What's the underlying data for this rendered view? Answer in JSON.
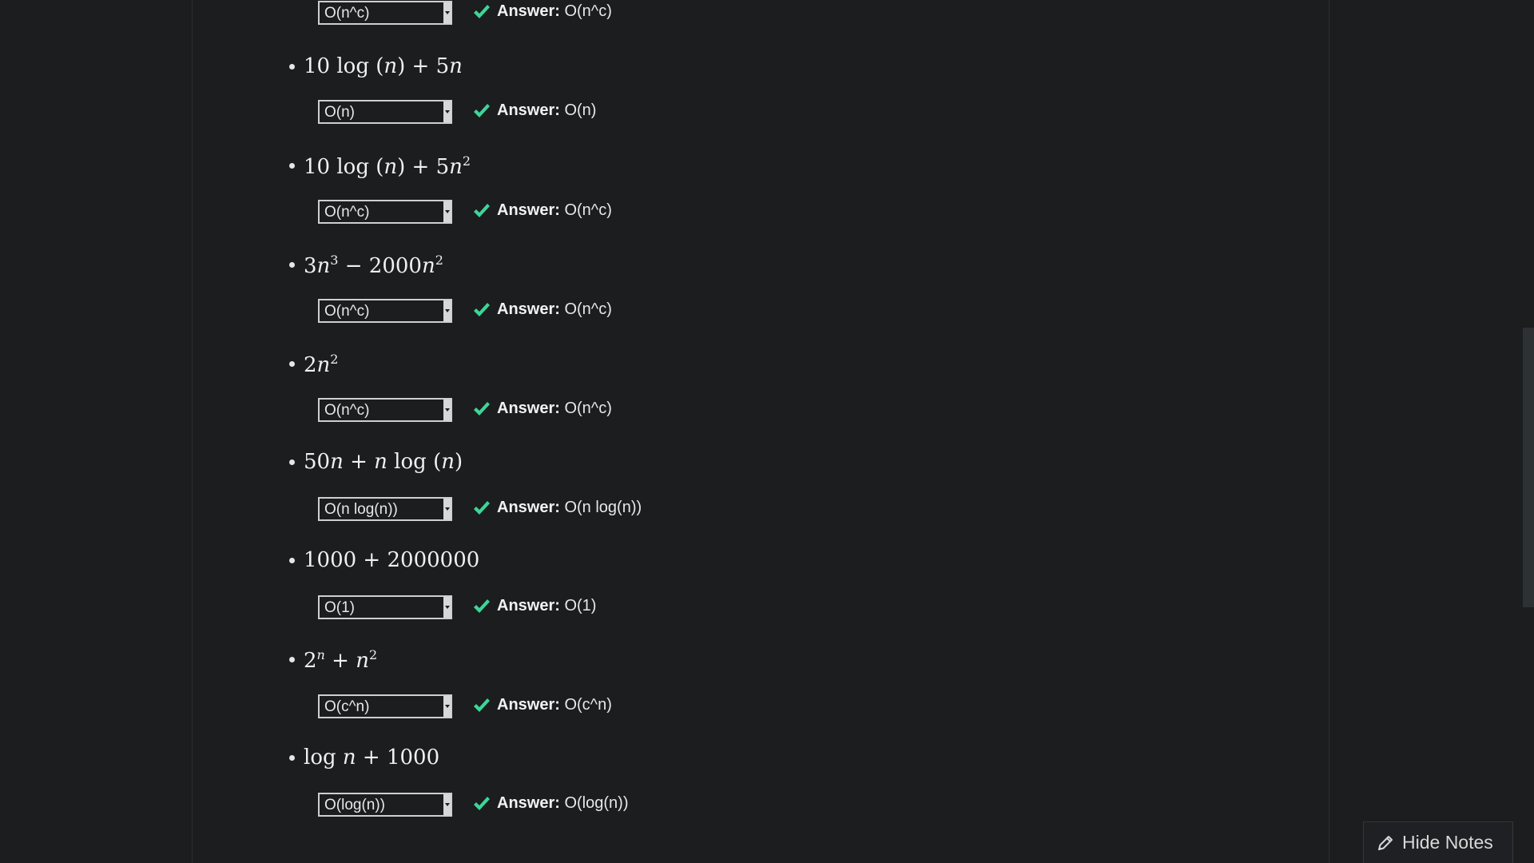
{
  "answer_label": "Answer:",
  "accent_color": "#3ed598",
  "questions": [
    {
      "expr_html": "",
      "selected": "O(n^c)",
      "answer": "O(n^c)"
    },
    {
      "expr_html": "10 log (<i>n</i>) + 5<i>n</i>",
      "selected": "O(n)",
      "answer": "O(n)"
    },
    {
      "expr_html": "10 log (<i>n</i>) + 5<i>n</i><sup>2</sup>",
      "selected": "O(n^c)",
      "answer": "O(n^c)"
    },
    {
      "expr_html": "3<i>n</i><sup>3</sup> − 2000<i>n</i><sup>2</sup>",
      "selected": "O(n^c)",
      "answer": "O(n^c)"
    },
    {
      "expr_html": "2<i>n</i><sup>2</sup>",
      "selected": "O(n^c)",
      "answer": "O(n^c)"
    },
    {
      "expr_html": "50<i>n</i> + <i>n</i> log (<i>n</i>)",
      "selected": "O(n log(n))",
      "answer": "O(n log(n))"
    },
    {
      "expr_html": "1000 + 2000000",
      "selected": "O(1)",
      "answer": "O(1)"
    },
    {
      "expr_html": "2<sup><i>n</i></sup> + <i>n</i><sup>2</sup>",
      "selected": "O(c^n)",
      "answer": "O(c^n)"
    },
    {
      "expr_html": "log <i>n</i> + 1000",
      "selected": "O(log(n))",
      "answer": "O(log(n))"
    }
  ],
  "hide_notes_label": "Hide Notes",
  "icons": {
    "check": "check-icon",
    "pencil": "pencil-icon"
  }
}
